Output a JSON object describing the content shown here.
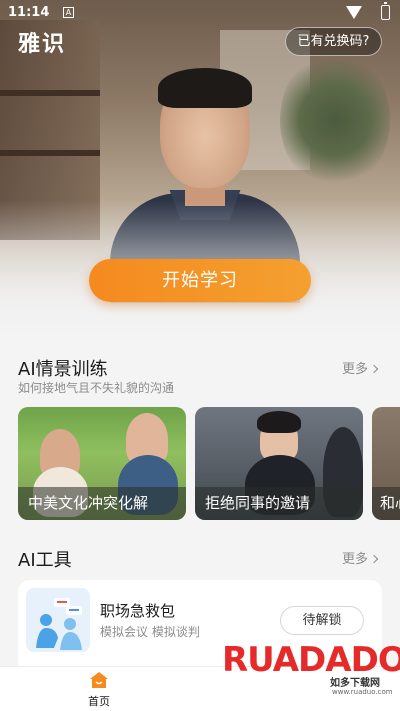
{
  "status_bar": {
    "time": "11:14",
    "notification_icon": "A"
  },
  "header": {
    "app_title": "雅识",
    "redeem_button": "已有兑换码?"
  },
  "hero": {
    "start_button": "开始学习"
  },
  "scenario_section": {
    "title": "AI情景训练",
    "subtitle": "如何接地气且不失礼貌的沟通",
    "more": "更多",
    "cards": [
      {
        "label": "中美文化冲突化解"
      },
      {
        "label": "拒绝同事的邀请"
      },
      {
        "label": "和心"
      }
    ]
  },
  "tools_section": {
    "title": "AI工具",
    "more": "更多",
    "tools": [
      {
        "name": "职场急救包",
        "desc": "模拟会议  模拟谈判",
        "action": "待解锁"
      }
    ]
  },
  "bottom_nav": {
    "items": [
      {
        "label": "首页",
        "icon": "home-icon",
        "active": true
      }
    ]
  },
  "watermark": {
    "logo": "RUADADO",
    "text": "如多下载网",
    "url": "www.ruaduo.com"
  },
  "colors": {
    "accent": "#f58a1f",
    "text_primary": "#1c1c1c",
    "text_secondary": "#8c8c8c"
  }
}
